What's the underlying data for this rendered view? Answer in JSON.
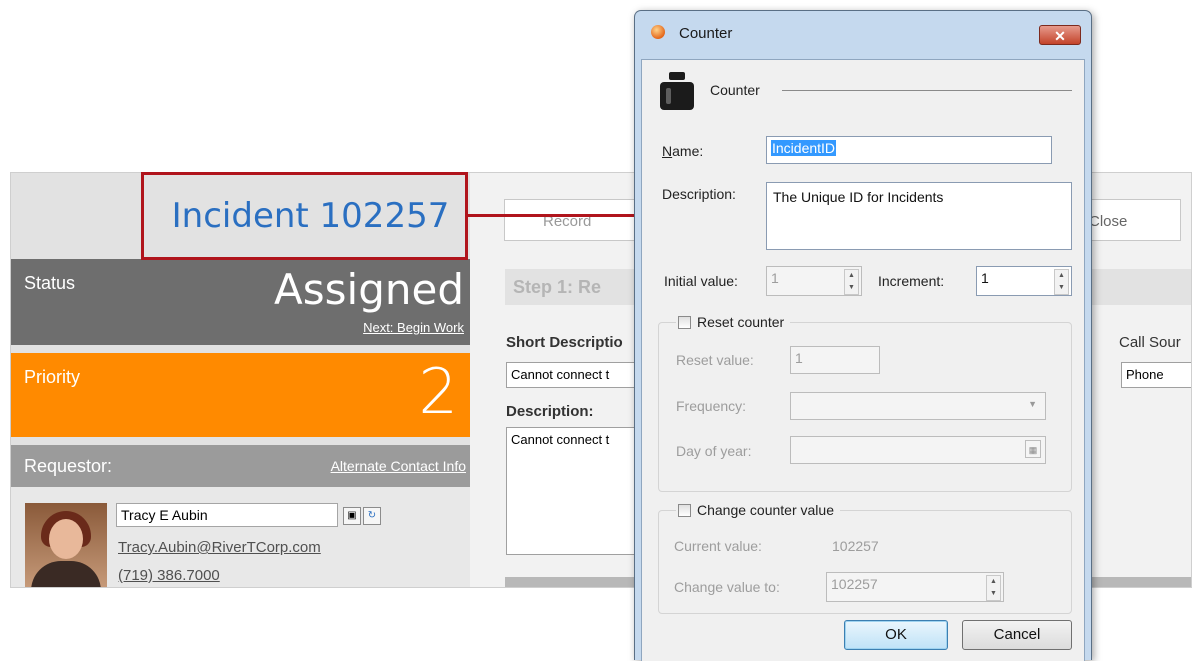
{
  "incident": {
    "title": "Incident 102257",
    "status_label": "Status",
    "status_value": "Assigned",
    "next_action": "Next: Begin Work",
    "priority_label": "Priority",
    "priority_value": "2",
    "requestor_label": "Requestor:",
    "alternate_contact": "Alternate Contact Info",
    "requestor_name": "Tracy E Aubin",
    "requestor_email": "Tracy.Aubin@RiverTCorp.com",
    "requestor_phone": "(719) 386.7000",
    "record_button": "Record",
    "close_button": "Close",
    "step_title": "Step 1: Re",
    "short_description_label": "Short Descriptio",
    "short_description_value": "Cannot connect t",
    "description_label": "Description:",
    "description_value": "Cannot connect t",
    "call_source_label": "Call Sour",
    "call_source_value": "Phone"
  },
  "dialog": {
    "window_title": "Counter",
    "close_glyph": "✕",
    "section_title": "Counter",
    "name_label": "Name:",
    "name_value": "IncidentID",
    "description_label": "Description:",
    "description_value": "The Unique ID for Incidents",
    "initial_value_label": "Initial value:",
    "initial_value": "1",
    "increment_label": "Increment:",
    "increment_value": "1",
    "reset_counter_label": "Reset counter",
    "reset_counter_checked": false,
    "reset_value_label": "Reset value:",
    "reset_value": "1",
    "frequency_label": "Frequency:",
    "frequency_value": "",
    "day_of_year_label": "Day of year:",
    "day_of_year_value": "",
    "change_counter_label": "Change counter value",
    "change_counter_checked": false,
    "current_value_label": "Current value:",
    "current_value": "102257",
    "change_value_to_label": "Change value to:",
    "change_value_to": "102257",
    "ok_button": "OK",
    "cancel_button": "Cancel"
  },
  "icons": {
    "spin_up": "▲",
    "spin_down": "▼",
    "dropdown_arrow": "▼",
    "calendar": "▦",
    "contact_card": "▣",
    "refresh": "↻"
  },
  "colors": {
    "incident_blue": "#2a6fc1",
    "status_gray": "#6e6e6e",
    "priority_orange": "#ff8a00",
    "callout_red": "#b0141c"
  }
}
